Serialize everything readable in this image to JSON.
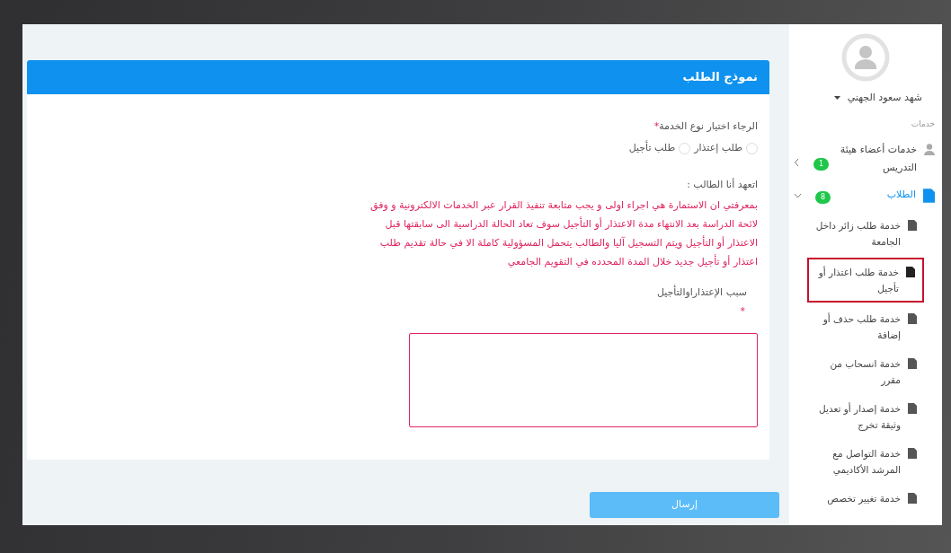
{
  "form": {
    "title": "نموذج الطلب",
    "service_label": "الرجاء اختيار نوع الخدمة",
    "service_required": "*",
    "service_options": [
      {
        "label": "طلب إعتذار",
        "selected": false
      },
      {
        "label": "طلب تأجيل",
        "selected": false
      }
    ],
    "pledge_title": "اتعهد أنا الطالب :",
    "pledge_text": "بمعرفتي ان الاستمارة هي اجراء اولى و يجب متابعة تنفيذ القرار عبر الخدمات الالكترونية و وفق لائحة الدراسة بعد الانتهاء مدة الاعتذار أو التأجيل سوف تعاد الحالة الدراسية الى سابقتها قبل الاعتذار أو التأجيل ويتم التسجيل آليا والطالب يتحمل المسؤولية كاملة الا في حالة تقديم طلب اعتذار أو تأجيل جديد خلال المدة المحدده في التقويم الجامعي",
    "reason_label": "سبب الإعتذاراوالتأجيل",
    "reason_required": "*"
  },
  "submit_button": "إرسال",
  "sidebar": {
    "user_name": "شهد سعود الجهني",
    "section_label": "خدمات",
    "groups": [
      {
        "label": "خدمات أعضاء هيئة التدريس",
        "badge": "1",
        "expanded": false,
        "active": false
      },
      {
        "label": "الطلاب",
        "badge": "8",
        "expanded": true,
        "active": true,
        "children": [
          {
            "label": "خدمة طلب زائر داخل الجامعة",
            "selected": false
          },
          {
            "label": "خدمة طلب اعتذار أو تأجيل",
            "selected": true
          },
          {
            "label": "خدمة طلب حذف أو إضافة",
            "selected": false
          },
          {
            "label": "خدمة انسحاب من مقرر",
            "selected": false
          },
          {
            "label": "خدمة إصدار أو تعديل وثيقة تخرج",
            "selected": false
          },
          {
            "label": "خدمة التواصل مع المرشد الأكاديمي",
            "selected": false
          },
          {
            "label": "خدمة تغيير تخصص",
            "selected": false
          }
        ]
      }
    ]
  }
}
